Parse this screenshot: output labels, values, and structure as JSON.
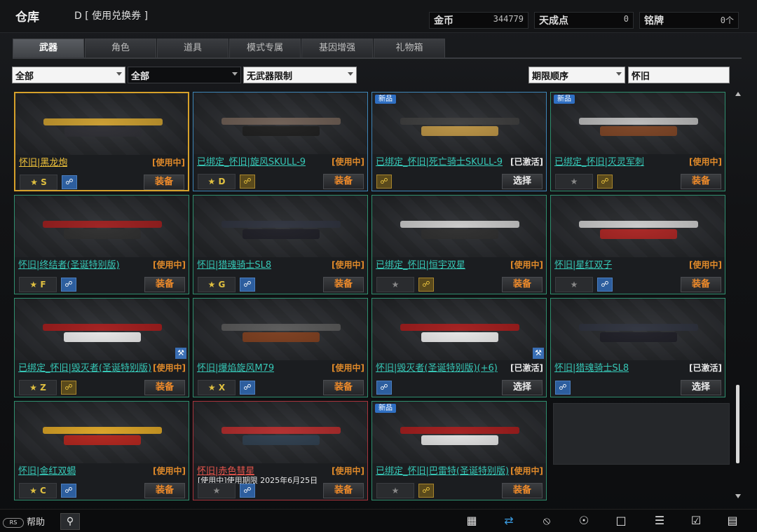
{
  "header": {
    "title": "仓库",
    "voucher": "D [ 使用兑换券 ]",
    "currencies": [
      {
        "label": "金币",
        "value": "344779"
      },
      {
        "label": "天成点",
        "value": "0"
      },
      {
        "label": "铭牌",
        "value": "0个"
      }
    ]
  },
  "tabs": [
    "武器",
    "角色",
    "道具",
    "模式专属",
    "基因增强",
    "礼物箱"
  ],
  "filters": {
    "f1": "全部",
    "f2": "全部",
    "f3": "无武器限制",
    "sort": "期限顺序",
    "search": "怀旧"
  },
  "items": [
    {
      "name": "怀旧|黑龙炮",
      "status": "[使用中]",
      "grade": "★ S",
      "lock": "open",
      "button": "装备"
    },
    {
      "name": "已绑定_怀旧|旋风SKULL-9",
      "status": "[使用中]",
      "grade": "★ D",
      "lock": "locked",
      "button": "装备"
    },
    {
      "badge": "新品",
      "name": "已绑定_怀旧|死亡骑士SKULL-9",
      "status": "[已激活]",
      "lock": "locked",
      "button": "选择"
    },
    {
      "badge": "新品",
      "name": "已绑定_怀旧|灭灵军刺",
      "status": "[使用中]",
      "grade": "★",
      "lock": "locked",
      "button": "装备"
    },
    {
      "name": "怀旧|终结者(圣诞特别版)",
      "status": "[使用中]",
      "grade": "★ F",
      "lock": "open",
      "button": "装备"
    },
    {
      "name": "怀旧|猎魂骑士SL8",
      "status": "[使用中]",
      "grade": "★ G",
      "lock": "open",
      "button": "装备"
    },
    {
      "name": "已绑定_怀旧|恒宇双星",
      "status": "[使用中]",
      "grade": "★",
      "lock": "locked",
      "button": "装备"
    },
    {
      "name": "怀旧|星红双子",
      "status": "[使用中]",
      "grade": "★",
      "lock": "open",
      "button": "装备"
    },
    {
      "name": "已绑定_怀旧|毁灭者(圣诞特别版)",
      "status": "[使用中]",
      "grade": "★ Z",
      "lock": "locked",
      "button": "装备"
    },
    {
      "name": "怀旧|爆焰旋风M79",
      "status": "[使用中]",
      "grade": "★ X",
      "lock": "open",
      "button": "装备"
    },
    {
      "name": "怀旧|毁灭者(圣诞特别版)(+6)",
      "status": "[已激活]",
      "lock": "open",
      "button": "选择"
    },
    {
      "name": "怀旧|猎魂骑士SL8",
      "status": "[已激活]",
      "lock": "open",
      "button": "选择"
    },
    {
      "name": "怀旧|金红双蝎",
      "status": "[使用中]",
      "grade": "★ C",
      "lock": "open",
      "button": "装备"
    },
    {
      "name": "怀旧|赤色彗星",
      "status": "[使用中]",
      "grade": "★",
      "lock": "open",
      "button": "装备",
      "expiry": "[使用中]使用期限 2025年6月25日"
    },
    {
      "badge": "新品",
      "name": "已绑定_怀旧|巴雷特(圣诞特别版)",
      "status": "[使用中]",
      "grade": "★",
      "lock": "locked",
      "button": "装备"
    }
  ],
  "bottom": {
    "help": "帮助",
    "key": "RS",
    "icons": [
      "calendar-icon",
      "swap-icon",
      "compass-icon",
      "runner-icon",
      "shop-icon",
      "list-icon",
      "checklist-icon",
      "film-icon"
    ]
  }
}
